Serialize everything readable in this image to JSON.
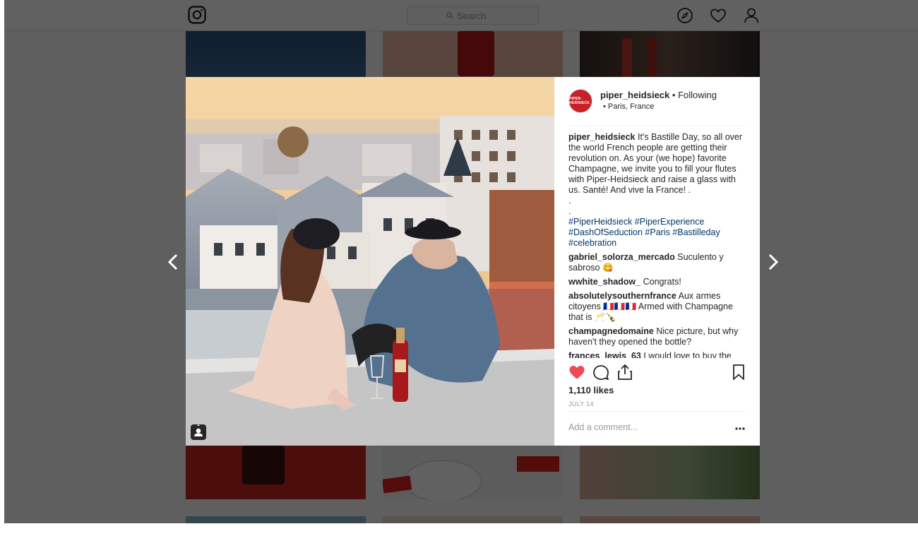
{
  "nav": {
    "search_placeholder": "Search",
    "icons": [
      "instagram-logo",
      "compass-icon",
      "heart-icon",
      "profile-icon"
    ]
  },
  "post": {
    "username": "piper_heidsieck",
    "separator": "•",
    "follow_status": "Following",
    "location": "• Paris, France",
    "avatar_text": "PIPER-HEIDSIECK",
    "caption_lines": [
      "It's Bastille Day, so all over the world French people are getting their revolution on. As your (we hope) favorite Champagne, we invite you to fill your flutes with Piper-Heidsieck and raise a glass with us. Santé! And vive la France! .",
      ".",
      "."
    ],
    "hashtags": "#PiperHeidsieck #PiperExperience #DashOfSeduction #Paris #Bastilleday #celebration",
    "comments": [
      {
        "user": "gabriel_solorza_mercado",
        "text": "Suculento y sabroso 😋"
      },
      {
        "user": "wwhite_shadow_",
        "text": "Congrats!"
      },
      {
        "user": "absolutelysouthernfrance",
        "text": "Aux armes citoyens 🇫🇷🇫🇷🇫🇷 Armed with Champagne that is 🥂🍾"
      },
      {
        "user": "champagnedomaine",
        "text": "Nice picture, but why haven't they opened the bottle?"
      },
      {
        "user": "frances_lewis_63",
        "text": "I would love to buy the"
      }
    ],
    "likes": "1,110 likes",
    "date": "JULY 14",
    "add_comment_placeholder": "Add a comment..."
  },
  "colors": {
    "heart_liked": "#ed4956",
    "brand_red": "#c62126",
    "hashtag": "#003569"
  }
}
